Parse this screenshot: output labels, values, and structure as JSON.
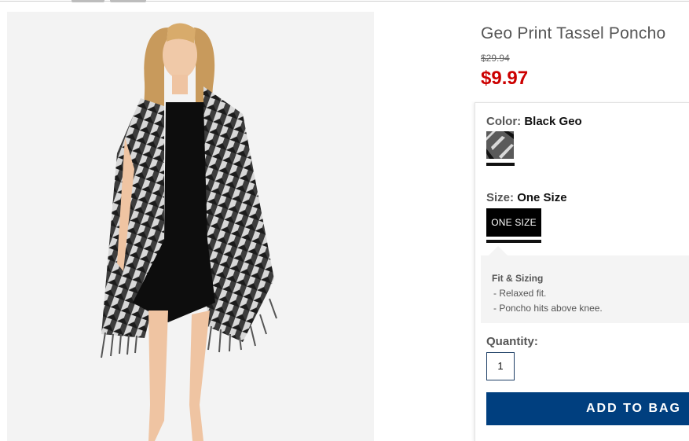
{
  "product": {
    "title": "Geo Print Tassel Poncho",
    "original_price": "$29.94",
    "sale_price": "$9.97"
  },
  "color": {
    "label": "Color:",
    "selected": "Black Geo",
    "swatch_icon": "geo-pattern-swatch"
  },
  "size": {
    "label": "Size:",
    "selected": "One Size",
    "options": [
      "ONE SIZE"
    ]
  },
  "fit_sizing": {
    "title": "Fit & Sizing",
    "items": [
      "-  Relaxed fit.",
      "-  Poncho hits above knee."
    ]
  },
  "quantity": {
    "label": "Quantity:",
    "value": "1"
  },
  "add_to_bag_label": "ADD TO BAG",
  "colors": {
    "sale_price": "#cc0000",
    "add_button": "#003f7f",
    "selected_size_bg": "#000000"
  }
}
